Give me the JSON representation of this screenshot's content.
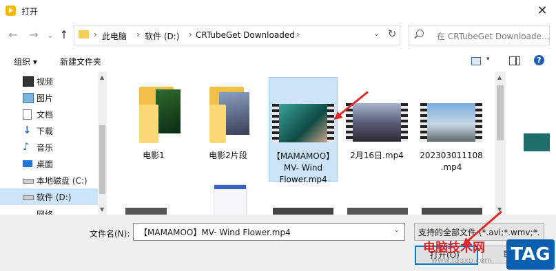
{
  "window": {
    "title": "打开",
    "close_glyph": "✕"
  },
  "nav": {
    "back": "←",
    "forward": "→",
    "dropdown": "⌄",
    "up": "↑"
  },
  "address": {
    "crumbs": [
      "此电脑",
      "软件 (D:)",
      "CRTubeGet Downloaded"
    ],
    "separator": "›",
    "dropdown": "⌄",
    "refresh": "↻"
  },
  "search": {
    "placeholder": "在 CRTubeGet Downloade..."
  },
  "toolbar": {
    "organize": "组织 ▾",
    "new_folder": "新建文件夹",
    "view_dropdown": "▾",
    "help": "?"
  },
  "sidebar": {
    "items": [
      {
        "label": "视频",
        "icon": "video-icon"
      },
      {
        "label": "图片",
        "icon": "pictures-icon"
      },
      {
        "label": "文档",
        "icon": "documents-icon"
      },
      {
        "label": "下载",
        "icon": "download-icon"
      },
      {
        "label": "音乐",
        "icon": "music-icon"
      },
      {
        "label": "桌面",
        "icon": "desktop-icon"
      },
      {
        "label": "本地磁盘 (C:)",
        "icon": "drive-icon"
      },
      {
        "label": "软件 (D:)",
        "icon": "drive-icon",
        "selected": true
      }
    ],
    "partial_item": "网络",
    "scroll_up": "▲",
    "scroll_down": "▼"
  },
  "files": [
    {
      "name": "电影1",
      "type": "folder"
    },
    {
      "name": "电影2片段",
      "type": "folder"
    },
    {
      "name": "【MAMAMOO】MV- Wind Flower.mp4",
      "type": "video",
      "selected": true
    },
    {
      "name": "2月16日.mp4",
      "type": "video"
    },
    {
      "name": "202303011108.mp4",
      "type": "video"
    }
  ],
  "content_scroll": {
    "up": "▲",
    "down": "▼"
  },
  "filename": {
    "label": "文件名(N):",
    "value": "【MAMAMOO】MV- Wind Flower.mp4",
    "dropdown": "⌄"
  },
  "filter": {
    "value": "支持的全部文件 (*.avi;*.wmv;*.",
    "dropdown": "⌄"
  },
  "buttons": {
    "open": "打开(O)",
    "cancel": "取消"
  },
  "watermark": {
    "site_name": "电脑技术网",
    "url": "www.tagxp.com",
    "badge": "TAG"
  },
  "colors": {
    "selection": "#cce4f7",
    "accent": "#0078d7",
    "folder": "#fbd974",
    "arrow": "#e12828",
    "badge": "#0a5fb0"
  }
}
